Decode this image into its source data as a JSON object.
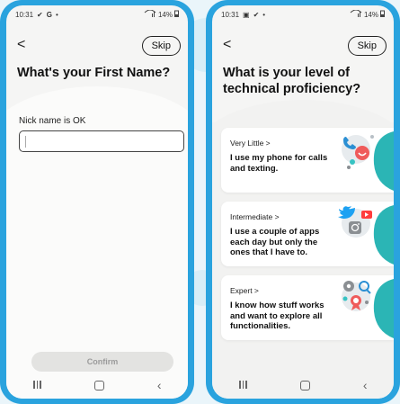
{
  "screens": [
    {
      "status": {
        "time": "10:31",
        "left_icons": [
          "✔",
          "G",
          "•"
        ],
        "right_text": "14%"
      },
      "back_label": "<",
      "skip_label": "Skip",
      "title": "What's your First Name?",
      "field_label": "Nick name is OK",
      "input_value": "",
      "confirm_label": "Confirm"
    },
    {
      "status": {
        "time": "10:31",
        "left_icons": [
          "▣",
          "✔",
          "•"
        ],
        "right_text": "14%"
      },
      "back_label": "<",
      "skip_label": "Skip",
      "title": "What is your level of technical proficiency?",
      "options": [
        {
          "level": "Very Little  >",
          "description": "I use my phone for calls and texting."
        },
        {
          "level": "Intermediate  >",
          "description": "I use a couple of apps each day but only the ones that I have to."
        },
        {
          "level": "Expert  >",
          "description": "I know how stuff works and want to explore all functionalities."
        }
      ]
    }
  ],
  "colors": {
    "frame": "#2aa3de",
    "teal": "#2bb5b5",
    "background": "#eaf5fa"
  },
  "icons": [
    "phone-icon",
    "smile-icon",
    "twitter-icon",
    "youtube-icon",
    "instagram-icon",
    "settings-icon",
    "search-icon",
    "badge-icon"
  ]
}
